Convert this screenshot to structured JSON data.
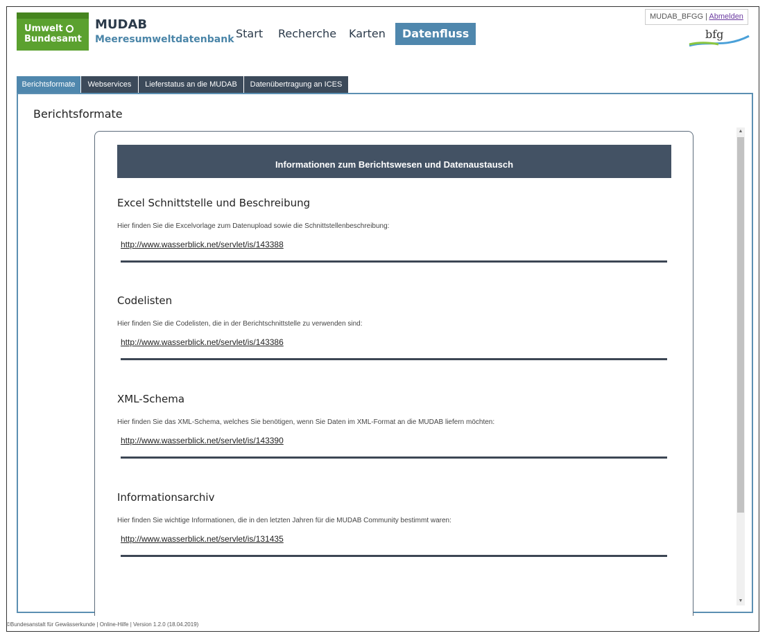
{
  "header": {
    "uba_logo": {
      "line1": "Umwelt",
      "line2": "Bundesamt",
      "icon": "globe-icon",
      "color": "#5ba12f"
    },
    "brand": {
      "title": "MUDAB",
      "subtitle": "Meeresumweltdatenbank"
    },
    "nav": [
      {
        "label": "Start",
        "active": false
      },
      {
        "label": "Recherche",
        "active": false
      },
      {
        "label": "Karten",
        "active": false
      },
      {
        "label": "Datenfluss",
        "active": true
      }
    ],
    "user": {
      "name": "MUDAB_BFGG",
      "separator": "|",
      "logout": "Abmelden"
    },
    "bfg_logo": {
      "text": "bfg",
      "icon": "wave-swoosh-icon"
    }
  },
  "tabs": [
    {
      "label": "Berichtsformate",
      "active": true
    },
    {
      "label": "Webservices",
      "active": false
    },
    {
      "label": "Lieferstatus an die MUDAB",
      "active": false
    },
    {
      "label": "Datenübertragung an ICES",
      "active": false
    }
  ],
  "main": {
    "title": "Berichtsformate",
    "card_header": "Informationen zum Berichtswesen und Datenaustausch",
    "sections": [
      {
        "heading": "Excel Schnittstelle und Beschreibung",
        "description": "Hier finden Sie die Excelvorlage zum Datenupload sowie die Schnittstellenbeschreibung:",
        "link": "http://www.wasserblick.net/servlet/is/143388"
      },
      {
        "heading": "Codelisten",
        "description": "Hier finden Sie die Codelisten, die in der Berichtschnittstelle zu verwenden sind:",
        "link": "http://www.wasserblick.net/servlet/is/143386"
      },
      {
        "heading": "XML-Schema",
        "description": "Hier finden Sie das XML-Schema, welches Sie benötigen, wenn Sie Daten im XML-Format an die MUDAB liefern möchten:",
        "link": "http://www.wasserblick.net/servlet/is/143390"
      },
      {
        "heading": "Informationsarchiv",
        "description": "Hier finden Sie wichtige Informationen, die in den letzten Jahren für die MUDAB Community bestimmt waren:",
        "link": "http://www.wasserblick.net/servlet/is/131435"
      }
    ]
  },
  "footer": {
    "text": "©Bundesanstalt für Gewässerkunde | Online-Hilfe | Version 1.2.0 (18.04.2019)"
  },
  "colors": {
    "accent": "#4f87ad",
    "dark_tab": "#3c4a5a",
    "card_header": "#435264",
    "uba_green": "#5ba12f"
  }
}
